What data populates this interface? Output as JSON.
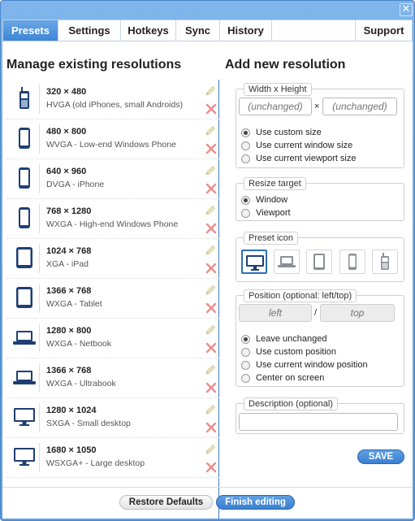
{
  "window": {
    "close_label": "✕"
  },
  "tabs": [
    {
      "label": "Presets",
      "active": true
    },
    {
      "label": "Settings"
    },
    {
      "label": "Hotkeys"
    },
    {
      "label": "Sync"
    },
    {
      "label": "History"
    },
    {
      "label": "Support"
    }
  ],
  "left": {
    "heading": "Manage existing resolutions",
    "presets": [
      {
        "title": "320 × 480",
        "desc": "HVGA (old iPhones, small Androids)",
        "icon": "feature-phone-icon"
      },
      {
        "title": "480 × 800",
        "desc": "WVGA - Low-end Windows Phone",
        "icon": "phone-icon"
      },
      {
        "title": "640 × 960",
        "desc": "DVGA - iPhone",
        "icon": "phone-icon"
      },
      {
        "title": "768 × 1280",
        "desc": "WXGA - High-end Windows Phone",
        "icon": "phone-icon"
      },
      {
        "title": "1024 × 768",
        "desc": "XGA - iPad",
        "icon": "tablet-icon"
      },
      {
        "title": "1366 × 768",
        "desc": "WXGA - Tablet",
        "icon": "tablet-icon"
      },
      {
        "title": "1280 × 800",
        "desc": "WXGA - Netbook",
        "icon": "laptop-icon"
      },
      {
        "title": "1366 × 768",
        "desc": "WXGA - Ultrabook",
        "icon": "laptop-icon"
      },
      {
        "title": "1280 × 1024",
        "desc": "SXGA - Small desktop",
        "icon": "desktop-icon"
      },
      {
        "title": "1680 × 1050",
        "desc": "WSXGA+ - Large desktop",
        "icon": "desktop-icon"
      }
    ]
  },
  "right": {
    "heading": "Add new resolution",
    "size": {
      "legend": "Width x Height",
      "width_placeholder": "(unchanged)",
      "height_placeholder": "(unchanged)",
      "separator": "×",
      "options": [
        {
          "label": "Use custom size",
          "checked": true
        },
        {
          "label": "Use current window size"
        },
        {
          "label": "Use current viewport size"
        }
      ]
    },
    "target": {
      "legend": "Resize target",
      "options": [
        {
          "label": "Window",
          "checked": true
        },
        {
          "label": "Viewport"
        }
      ]
    },
    "icon": {
      "legend": "Preset icon",
      "options": [
        "desktop-icon",
        "laptop-icon",
        "tablet-icon",
        "phone-icon",
        "feature-phone-icon"
      ],
      "selected": "desktop-icon"
    },
    "position": {
      "legend": "Position (optional: left/top)",
      "left_placeholder": "left",
      "top_placeholder": "top",
      "separator": "/",
      "options": [
        {
          "label": "Leave unchanged",
          "checked": true
        },
        {
          "label": "Use custom position"
        },
        {
          "label": "Use current window position"
        },
        {
          "label": "Center on screen"
        }
      ]
    },
    "description": {
      "legend": "Description (optional)",
      "value": ""
    },
    "save_label": "SAVE"
  },
  "footer": {
    "restore_label": "Restore Defaults",
    "finish_label": "Finish editing"
  },
  "colors": {
    "accent": "#3f86d6",
    "frame": "#6aa7e6",
    "delete": "#f08a8a",
    "icon": "#1f3f73"
  }
}
